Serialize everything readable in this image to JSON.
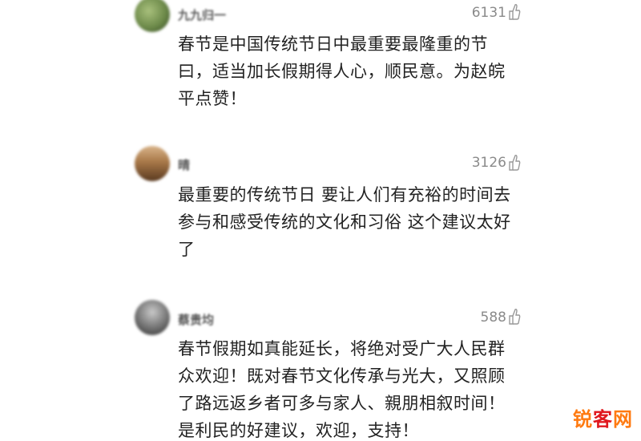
{
  "comments": [
    {
      "username": "九九归一",
      "likes": "6131",
      "lines": [
        "春节是中国传统节日中最重要最隆重的节",
        "曰，适当加长假期得人心，顺民意。为赵皖",
        "平点赞！"
      ],
      "avatar_colors": [
        "#8fae6a",
        "#3d5a2a"
      ]
    },
    {
      "username": "晴",
      "likes": "3126",
      "lines": [
        "最重要的传统节日 要让人们有充裕的时间去",
        "参与和感受传统的文化和习俗 这个建议太好",
        "了"
      ],
      "avatar_colors": [
        "#c79a6a",
        "#6b4a2e"
      ]
    },
    {
      "username": "蔡贵均",
      "likes": "588",
      "lines": [
        "春节假期如真能延长，将绝对受广大人民群",
        "众欢迎！既对春节文化传承与光大，又照顾",
        "了路远返乡者可多与家人、親朋相叙时间！",
        "是利民的好建议，欢迎，支持！"
      ],
      "avatar_colors": [
        "#9a9a9a",
        "#3a3a3a"
      ]
    }
  ],
  "icons": {
    "like": "thumb-up-icon"
  },
  "watermark": {
    "part1": "锐",
    "part2": "客",
    "part3": "网"
  }
}
